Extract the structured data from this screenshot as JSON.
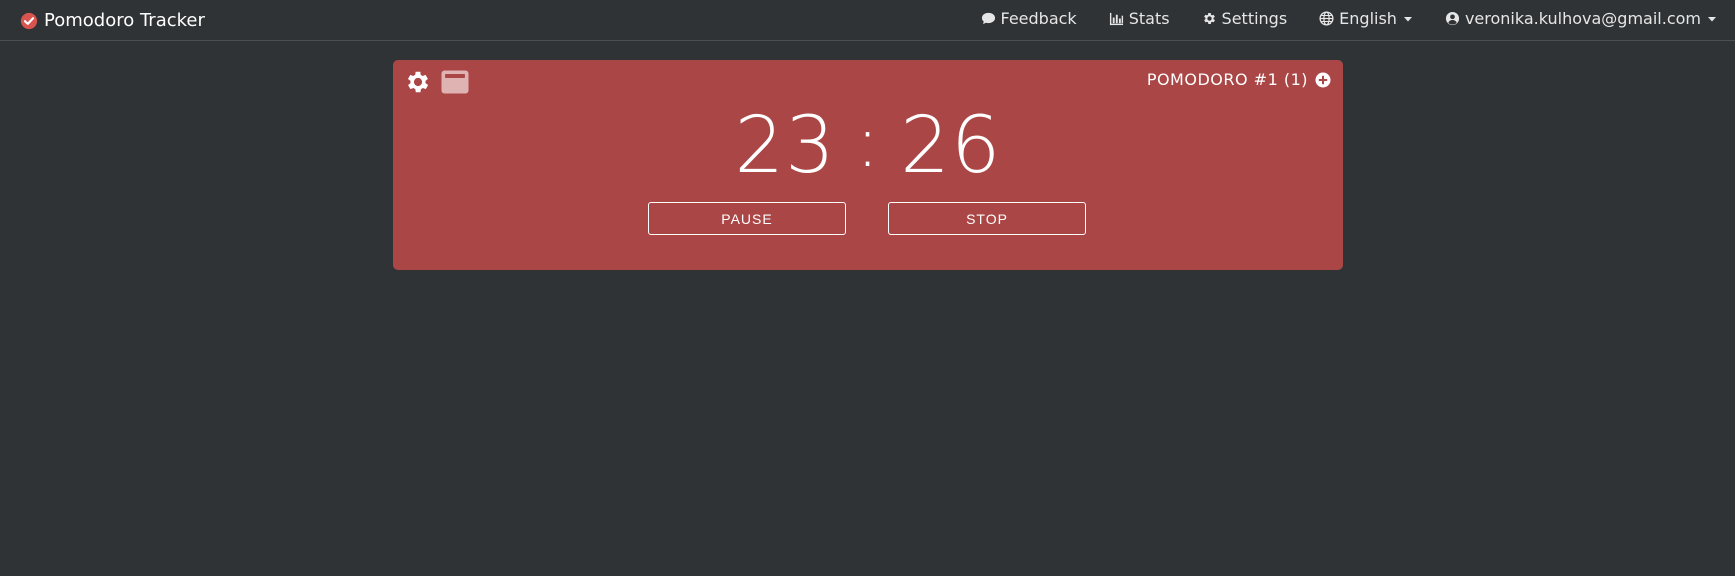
{
  "app": {
    "title": "Pomodoro Tracker"
  },
  "nav": {
    "feedback": "Feedback",
    "stats": "Stats",
    "settings": "Settings",
    "language": "English",
    "account": "veronika.kulhova@gmail.com"
  },
  "timer": {
    "label": "POMODORO #1 (1)",
    "minutes": "23",
    "separator": ":",
    "seconds": "26",
    "pause_label": "PAUSE",
    "stop_label": "STOP"
  },
  "colors": {
    "background": "#2f3336",
    "card": "#ab4646",
    "brand_check": "#d9534f"
  },
  "icons": [
    "check-circle-icon",
    "comment-icon",
    "bar-chart-icon",
    "gear-icon",
    "globe-icon",
    "caret-down-icon",
    "user-circle-icon",
    "window-icon",
    "plus-circle-icon"
  ]
}
